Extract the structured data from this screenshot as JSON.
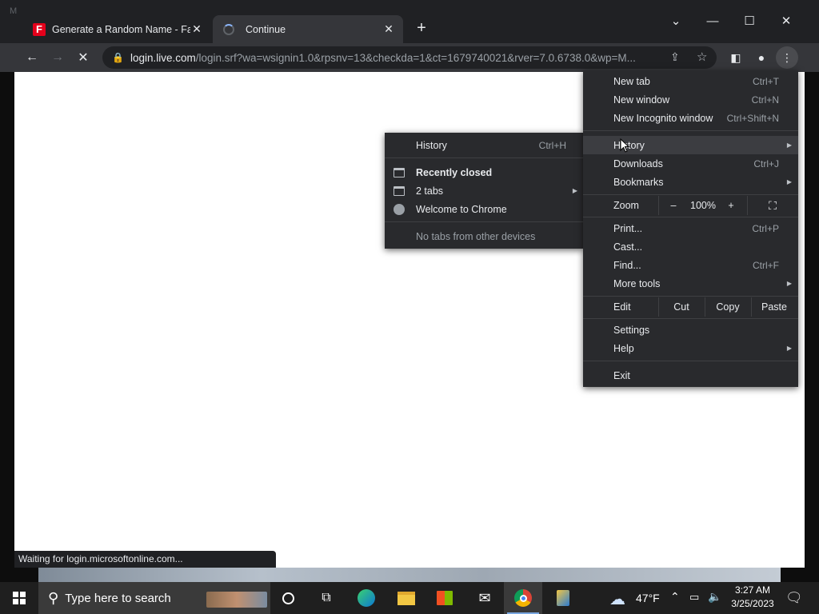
{
  "window": {
    "corner_letter": "M"
  },
  "tabs": [
    {
      "title": "Generate a Random Name - Fake",
      "favicon": "F",
      "state": "inactive"
    },
    {
      "title": "Continue",
      "state": "loading"
    }
  ],
  "toolbar": {
    "url_host": "login.live.com",
    "url_rest": "/login.srf?wa=wsignin1.0&rpsnv=13&checkda=1&ct=1679740021&rver=7.0.6738.0&wp=M..."
  },
  "status_text": "Waiting for login.microsoftonline.com...",
  "main_menu": {
    "new_tab": {
      "label": "New tab",
      "shortcut": "Ctrl+T"
    },
    "new_window": {
      "label": "New window",
      "shortcut": "Ctrl+N"
    },
    "incognito": {
      "label": "New Incognito window",
      "shortcut": "Ctrl+Shift+N"
    },
    "history": {
      "label": "History"
    },
    "downloads": {
      "label": "Downloads",
      "shortcut": "Ctrl+J"
    },
    "bookmarks": {
      "label": "Bookmarks"
    },
    "zoom": {
      "label": "Zoom",
      "minus": "–",
      "value": "100%",
      "plus": "+"
    },
    "print": {
      "label": "Print...",
      "shortcut": "Ctrl+P"
    },
    "cast": {
      "label": "Cast..."
    },
    "find": {
      "label": "Find...",
      "shortcut": "Ctrl+F"
    },
    "more_tools": {
      "label": "More tools"
    },
    "edit": {
      "label": "Edit",
      "cut": "Cut",
      "copy": "Copy",
      "paste": "Paste"
    },
    "settings": {
      "label": "Settings"
    },
    "help": {
      "label": "Help"
    },
    "exit": {
      "label": "Exit"
    }
  },
  "history_menu": {
    "history": {
      "label": "History",
      "shortcut": "Ctrl+H"
    },
    "recently_closed": "Recently closed",
    "two_tabs": "2 tabs",
    "welcome": "Welcome to Chrome",
    "no_tabs": "No tabs from other devices"
  },
  "taskbar": {
    "search_placeholder": "Type here to search",
    "weather": "47°F",
    "time": "3:27 AM",
    "date": "3/25/2023"
  }
}
